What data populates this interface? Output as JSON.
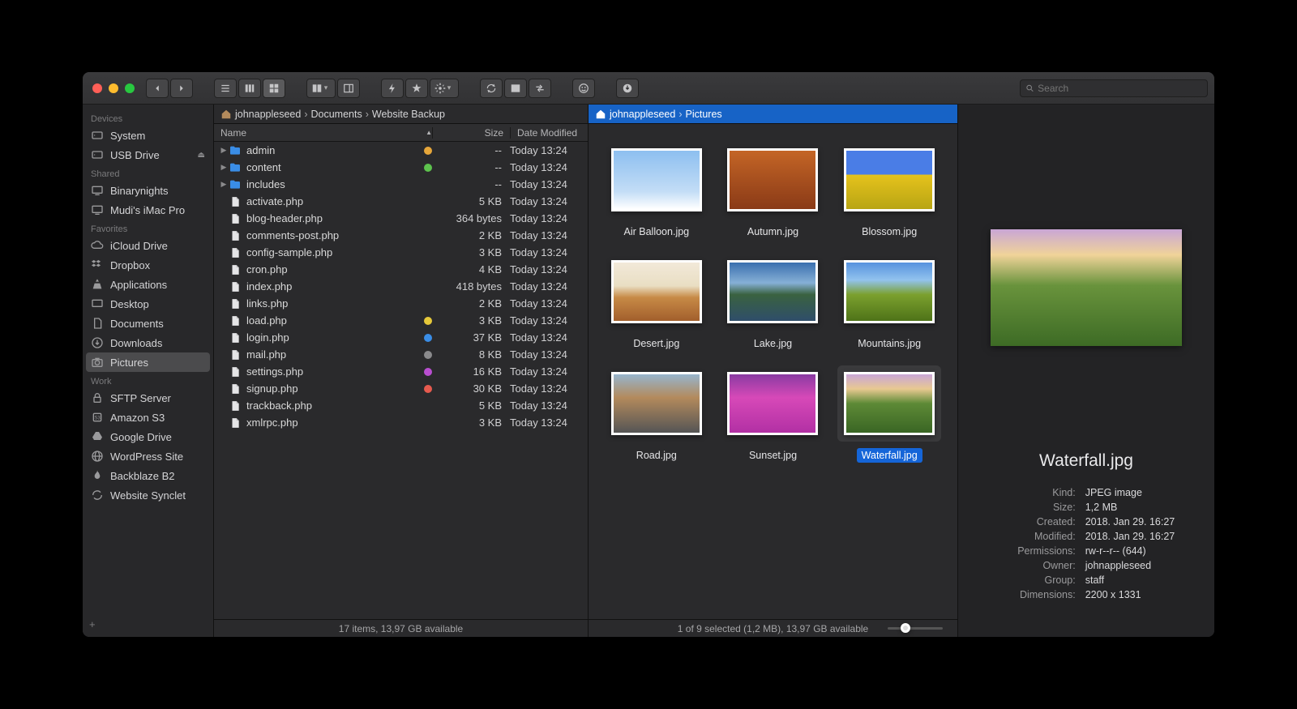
{
  "search": {
    "placeholder": "Search"
  },
  "sidebar": {
    "groups": [
      {
        "header": "Devices",
        "items": [
          {
            "label": "System",
            "icon": "hdd"
          },
          {
            "label": "USB Drive",
            "icon": "hdd",
            "eject": true
          }
        ]
      },
      {
        "header": "Shared",
        "items": [
          {
            "label": "Binarynights",
            "icon": "display"
          },
          {
            "label": "Mudi's iMac Pro",
            "icon": "display"
          }
        ]
      },
      {
        "header": "Favorites",
        "items": [
          {
            "label": "iCloud Drive",
            "icon": "icloud"
          },
          {
            "label": "Dropbox",
            "icon": "dropbox"
          },
          {
            "label": "Applications",
            "icon": "apps"
          },
          {
            "label": "Desktop",
            "icon": "desktop"
          },
          {
            "label": "Documents",
            "icon": "doc"
          },
          {
            "label": "Downloads",
            "icon": "down"
          },
          {
            "label": "Pictures",
            "icon": "camera",
            "active": true
          }
        ]
      },
      {
        "header": "Work",
        "items": [
          {
            "label": "SFTP Server",
            "icon": "lock"
          },
          {
            "label": "Amazon S3",
            "icon": "s3"
          },
          {
            "label": "Google Drive",
            "icon": "gdrive"
          },
          {
            "label": "WordPress Site",
            "icon": "globe"
          },
          {
            "label": "Backblaze B2",
            "icon": "flame"
          },
          {
            "label": "Website Synclet",
            "icon": "sync"
          }
        ]
      }
    ]
  },
  "leftPane": {
    "breadcrumb": [
      "johnappleseed",
      "Documents",
      "Website Backup"
    ],
    "columns": {
      "name": "Name",
      "size": "Size",
      "date": "Date Modified"
    },
    "files": [
      {
        "name": "admin",
        "type": "folder",
        "size": "--",
        "date": "Today 13:24",
        "tag": "#e6a63a"
      },
      {
        "name": "content",
        "type": "folder",
        "size": "--",
        "date": "Today 13:24",
        "tag": "#5dc24d"
      },
      {
        "name": "includes",
        "type": "folder",
        "size": "--",
        "date": "Today 13:24"
      },
      {
        "name": "activate.php",
        "type": "file",
        "size": "5 KB",
        "date": "Today 13:24"
      },
      {
        "name": "blog-header.php",
        "type": "file",
        "size": "364 bytes",
        "date": "Today 13:24"
      },
      {
        "name": "comments-post.php",
        "type": "file",
        "size": "2 KB",
        "date": "Today 13:24"
      },
      {
        "name": "config-sample.php",
        "type": "file",
        "size": "3 KB",
        "date": "Today 13:24"
      },
      {
        "name": "cron.php",
        "type": "file",
        "size": "4 KB",
        "date": "Today 13:24"
      },
      {
        "name": "index.php",
        "type": "file",
        "size": "418 bytes",
        "date": "Today 13:24"
      },
      {
        "name": "links.php",
        "type": "file",
        "size": "2 KB",
        "date": "Today 13:24"
      },
      {
        "name": "load.php",
        "type": "file",
        "size": "3 KB",
        "date": "Today 13:24",
        "tag": "#e6c83a"
      },
      {
        "name": "login.php",
        "type": "file",
        "size": "37 KB",
        "date": "Today 13:24",
        "tag": "#3a8de6"
      },
      {
        "name": "mail.php",
        "type": "file",
        "size": "8 KB",
        "date": "Today 13:24",
        "tag": "#8a8a8c"
      },
      {
        "name": "settings.php",
        "type": "file",
        "size": "16 KB",
        "date": "Today 13:24",
        "tag": "#b94ed0"
      },
      {
        "name": "signup.php",
        "type": "file",
        "size": "30 KB",
        "date": "Today 13:24",
        "tag": "#e65a4e"
      },
      {
        "name": "trackback.php",
        "type": "file",
        "size": "5 KB",
        "date": "Today 13:24"
      },
      {
        "name": "xmlrpc.php",
        "type": "file",
        "size": "3 KB",
        "date": "Today 13:24"
      }
    ],
    "status": "17 items, 13,97 GB available"
  },
  "midPane": {
    "breadcrumb": [
      "johnappleseed",
      "Pictures"
    ],
    "items": [
      {
        "label": "Air Balloon.jpg",
        "class": "th-balloon"
      },
      {
        "label": "Autumn.jpg",
        "class": "th-autumn"
      },
      {
        "label": "Blossom.jpg",
        "class": "th-blossom"
      },
      {
        "label": "Desert.jpg",
        "class": "th-desert"
      },
      {
        "label": "Lake.jpg",
        "class": "th-lake"
      },
      {
        "label": "Mountains.jpg",
        "class": "th-mountains"
      },
      {
        "label": "Road.jpg",
        "class": "th-road"
      },
      {
        "label": "Sunset.jpg",
        "class": "th-sunset"
      },
      {
        "label": "Waterfall.jpg",
        "class": "th-waterfall",
        "selected": true
      }
    ],
    "status": "1 of 9 selected (1,2 MB), 13,97 GB available"
  },
  "preview": {
    "title": "Waterfall.jpg",
    "meta": [
      {
        "k": "Kind:",
        "v": "JPEG image"
      },
      {
        "k": "Size:",
        "v": "1,2 MB"
      },
      {
        "k": "Created:",
        "v": "2018. Jan 29. 16:27"
      },
      {
        "k": "Modified:",
        "v": "2018. Jan 29. 16:27"
      },
      {
        "k": "Permissions:",
        "v": "rw-r--r-- (644)"
      },
      {
        "k": "Owner:",
        "v": "johnappleseed"
      },
      {
        "k": "Group:",
        "v": "staff"
      },
      {
        "k": "Dimensions:",
        "v": "2200 x 1331"
      }
    ]
  }
}
